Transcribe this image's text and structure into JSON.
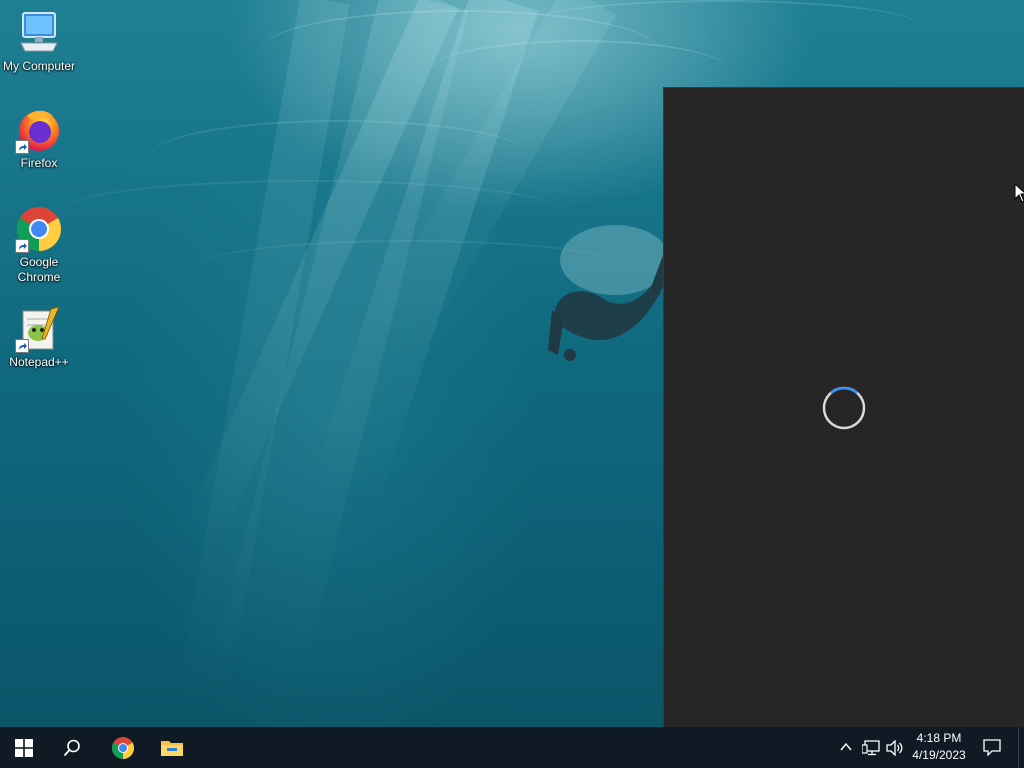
{
  "desktop": {
    "icons": [
      {
        "name": "my-computer",
        "label": "My Computer",
        "icon": "computer-icon",
        "shortcut": false
      },
      {
        "name": "firefox",
        "label": "Firefox",
        "icon": "firefox-icon",
        "shortcut": true
      },
      {
        "name": "google-chrome",
        "label": "Google Chrome",
        "icon": "chrome-icon",
        "shortcut": true
      },
      {
        "name": "notepad-plus-plus",
        "label": "Notepad++",
        "icon": "notepad-plus-plus-icon",
        "shortcut": true
      }
    ]
  },
  "loading_panel": {
    "state": "loading",
    "spinner_icon": "loading-spinner-icon",
    "background_color": "#272525",
    "spinner_color": "#2f8fff"
  },
  "taskbar": {
    "start_icon": "windows-start-icon",
    "search_icon": "search-icon",
    "pinned_apps": [
      {
        "name": "google-chrome",
        "icon": "chrome-icon"
      },
      {
        "name": "file-explorer",
        "icon": "folder-icon"
      }
    ],
    "tray": {
      "chevron_icon": "chevron-up-icon",
      "network_icon": "network-icon",
      "volume_icon": "volume-icon",
      "time": "4:18 PM",
      "date": "4/19/2023",
      "notification_icon": "notification-icon"
    },
    "background_color": "#101a24"
  },
  "colors": {
    "accent": "#0078d7",
    "wallpaper_base": "#10697e"
  }
}
